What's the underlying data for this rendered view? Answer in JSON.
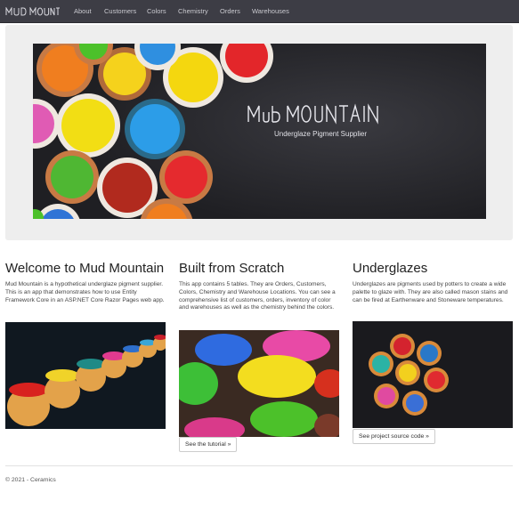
{
  "navbar": {
    "brand": "MUD MOUNTAIN",
    "items": [
      {
        "label": "About"
      },
      {
        "label": "Customers"
      },
      {
        "label": "Colors"
      },
      {
        "label": "Chemistry"
      },
      {
        "label": "Orders"
      },
      {
        "label": "Warehouses"
      }
    ]
  },
  "banner": {
    "title": "Mud MOUNTAIN",
    "subtitle": "Underglaze Pigment Supplier"
  },
  "columns": [
    {
      "heading": "Welcome to Mud Mountain",
      "body": "Mud Mountain is a hypothetical underglaze pigment supplier. This is an app that demonstrates how to use Entity Framework Core in an ASP.NET Core Razor Pages web app."
    },
    {
      "heading": "Built from Scratch",
      "body": "This app contains 5 tables. They are Orders, Customers, Colors, Chemistry and Warehouse Locations. You can see a comprehensive list of customers, orders, inventory of color and warehouses as well as the chemistry behind the colors.",
      "button": "See the tutorial »"
    },
    {
      "heading": "Underglazes",
      "body": "Underglazes are pigments used by potters to create a wide palette to glaze with. They are also called mason stains and can be fired at Earthenware and Stoneware temperatures.",
      "button": "See project source code »"
    }
  ],
  "footer": {
    "text": "© 2021 - Ceramics"
  },
  "colors": {
    "navbar_bg": "#3d3d45",
    "jumbotron_bg": "#eeeeee",
    "banner_bg": "#232327"
  }
}
